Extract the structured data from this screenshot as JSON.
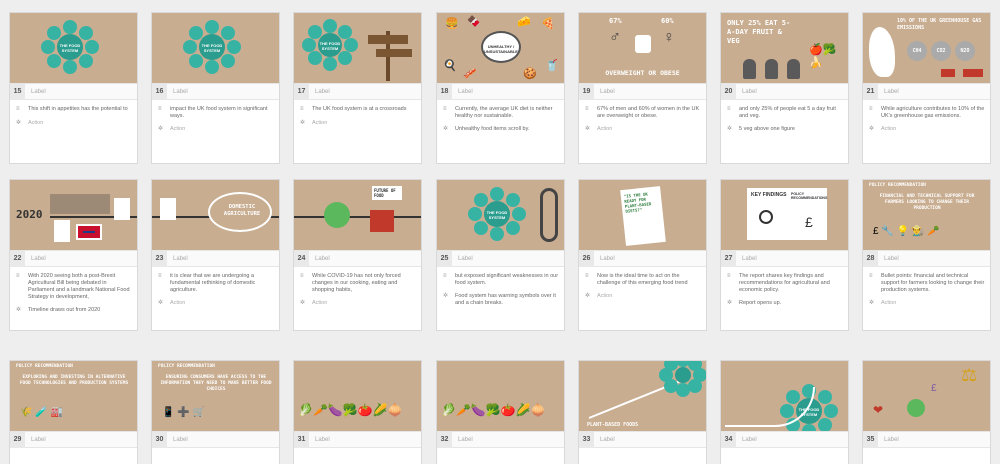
{
  "frame_label": "Label",
  "cards": [
    {
      "num": "15",
      "kind": "system",
      "hub": "THE FOOD SYSTEM",
      "body": "This shift in appetites has the potential to",
      "action": "Action"
    },
    {
      "num": "16",
      "kind": "system2",
      "hub": "THE FOOD SYSTEM",
      "body": "impact the UK food system in significant ways.",
      "action": "Action"
    },
    {
      "num": "17",
      "kind": "signpost",
      "hub": "THE FOOD SYSTEM",
      "body": "The UK food system is at a crossroads",
      "action": "Action"
    },
    {
      "num": "18",
      "kind": "foods",
      "hub": "UNHEALTHY / UNSUSTAINABLE",
      "body": "Currently, the average UK diet is neither healthy nor sustainable.",
      "body2": "Unhealthy food items scroll by.",
      "action": ""
    },
    {
      "num": "19",
      "kind": "obese",
      "stat1": "67%",
      "stat2": "60%",
      "caption": "OVERWEIGHT OR OBESE",
      "body": "67% of men and 60% of women in the UK are overweight or obese.",
      "action": "Action"
    },
    {
      "num": "20",
      "kind": "fiveaday",
      "title": "ONLY 25% EAT 5-A-DAY FRUIT & VEG",
      "body": "and only 25% of people eat 5 a day fruit and veg.",
      "body2": "5 veg above one figure",
      "action": ""
    },
    {
      "num": "21",
      "kind": "ukmap",
      "title": "10% OF THE UK GREENHOUSE GAS EMISSIONS",
      "gases": [
        "CH4",
        "CO2",
        "N2O"
      ],
      "body": "While agriculture contributes to 10% of the UK's greenhouse gas emissions.",
      "action": "Action"
    },
    {
      "num": "22",
      "kind": "brexit",
      "year": "2020",
      "body": "With 2020 seeing both a post-Brexit Agricultural Bill being debated in Parliament and a landmark National Food Strategy in development,",
      "body2": "Timeline draws out from 2020",
      "action": ""
    },
    {
      "num": "23",
      "kind": "domestic",
      "title": "DOMESTIC AGRICULTURE",
      "body": "it is clear that we are undergoing a fundamental rethinking of domestic agriculture.",
      "action": "Action"
    },
    {
      "num": "24",
      "kind": "covid",
      "tag": "FUTURE OF FOOD",
      "body": "While COVID-19 has not only forced changes in our cooking, eating and shopping habits,",
      "action": "Action"
    },
    {
      "num": "25",
      "kind": "chain",
      "hub": "THE FOOD SYSTEM",
      "body": "but exposed significant weaknesses in our food system.",
      "body2": "Food system has warning symbols over it and a chain breaks.",
      "action": ""
    },
    {
      "num": "26",
      "kind": "report",
      "tag": "\"IS THE UK READY FOR PLANT-BASED DIETS?\"",
      "body": "Now is the ideal time to act on the challenge of this emerging food trend",
      "action": "Action"
    },
    {
      "num": "27",
      "kind": "findings",
      "tag": "KEY FINDINGS",
      "tag2": "POLICY RECOMMENDATIONS",
      "body": "The report shares key findings and recommendations for agricultural and economic policy.",
      "body2": "Report opens up.",
      "action": ""
    },
    {
      "num": "28",
      "kind": "policy",
      "head": "POLICY RECOMMENDATION",
      "title": "FINANCIAL AND TECHNICAL SUPPORT FOR FARMERS LOOKING TO CHANGE THEIR PRODUCTION",
      "body": "Bullet points: financial and technical support for farmers looking to change their production systems.",
      "action": "Action"
    },
    {
      "num": "29",
      "kind": "policy2",
      "head": "POLICY RECOMMENDATION",
      "title": "EXPLORING AND INVESTING IN ALTERNATIVE FOOD TECHNOLOGIES AND PRODUCTION SYSTEMS",
      "body": "",
      "action": ""
    },
    {
      "num": "30",
      "kind": "policy3",
      "head": "POLICY RECOMMENDATION",
      "title": "ENSURING CONSUMERS HAVE ACCESS TO THE INFORMATION THEY NEED TO MAKE BETTER FOOD CHOICES",
      "body": "",
      "action": ""
    },
    {
      "num": "31",
      "kind": "veg",
      "body": "",
      "action": ""
    },
    {
      "num": "32",
      "kind": "veg2",
      "body": "",
      "action": ""
    },
    {
      "num": "33",
      "kind": "growth",
      "caption": "PLANT-BASED FOODS",
      "body": "",
      "action": ""
    },
    {
      "num": "34",
      "kind": "growth2",
      "hub": "THE FOOD SYSTEM",
      "body": "",
      "action": ""
    },
    {
      "num": "35",
      "kind": "benefits",
      "body": "",
      "action": ""
    }
  ],
  "colors": {
    "tan": "#c8ad91",
    "teal": "#2a9d8f",
    "white": "#ffffff"
  }
}
